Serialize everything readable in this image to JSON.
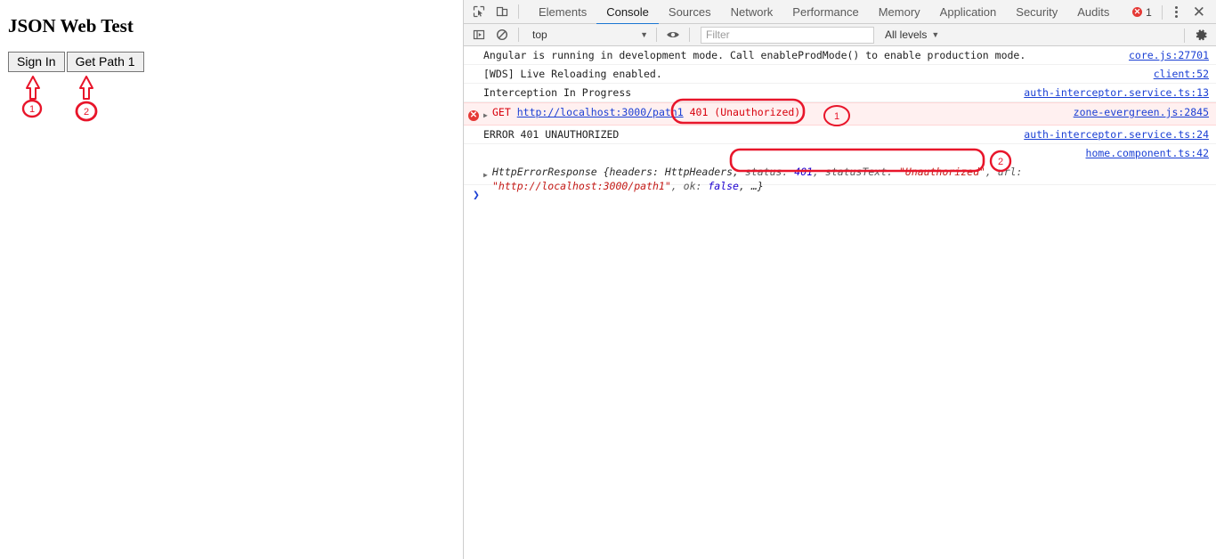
{
  "webpage": {
    "title": "JSON Web Test",
    "buttons": [
      {
        "label": "Sign In",
        "name": "sign-in-button"
      },
      {
        "label": "Get Path 1",
        "name": "get-path-1-button"
      }
    ],
    "annotations": [
      {
        "number": "1",
        "target": "Sign In button"
      },
      {
        "number": "2",
        "target": "Get Path 1 button"
      }
    ]
  },
  "devtools": {
    "tabs": [
      {
        "label": "Elements",
        "active": false
      },
      {
        "label": "Console",
        "active": true
      },
      {
        "label": "Sources",
        "active": false
      },
      {
        "label": "Network",
        "active": false
      },
      {
        "label": "Performance",
        "active": false
      },
      {
        "label": "Memory",
        "active": false
      },
      {
        "label": "Application",
        "active": false
      },
      {
        "label": "Security",
        "active": false
      },
      {
        "label": "Audits",
        "active": false
      }
    ],
    "error_count": "1",
    "error_badge_glyph": "✕",
    "close_glyph": "✕",
    "toolbar_icons": {
      "inspect": "inspect-element-icon",
      "device": "device-toolbar-icon",
      "sidebar": "console-sidebar-icon",
      "clear": "clear-console-icon",
      "eye": "live-expression-icon",
      "gear": "settings-gear-icon"
    },
    "console_toolbar": {
      "context": "top",
      "context_caret": "▼",
      "filter_placeholder": "Filter",
      "filter_value": "",
      "levels": "All levels",
      "levels_caret": "▼"
    },
    "messages": [
      {
        "type": "log",
        "text": "Angular is running in development mode. Call enableProdMode() to enable production mode.",
        "source": "core.js:27701"
      },
      {
        "type": "log",
        "text": "[WDS] Live Reloading enabled.",
        "source": "client:52"
      },
      {
        "type": "log",
        "text": "Interception In Progress",
        "source": "auth-interceptor.service.ts:13"
      },
      {
        "type": "error",
        "method": "GET",
        "url": "http://localhost:3000/path1",
        "status_text": "401 (Unauthorized)",
        "source": "zone-evergreen.js:2845"
      },
      {
        "type": "log",
        "text": "ERROR 401 UNAUTHORIZED",
        "source": "auth-interceptor.service.ts:24"
      },
      {
        "type": "object",
        "class_name": "HttpErrorResponse",
        "prefix": " {headers: HttpHeaders, ",
        "k_status": "status: ",
        "v_status": "401",
        "k_statusText": ", statusText: ",
        "v_statusText": "\"Unauthorized\"",
        "k_url": ", url: ",
        "v_url": "\"http://localhost:3000/path1\"",
        "k_ok": ", ok: ",
        "v_ok": "false",
        "suffix": ", …}",
        "source": "home.component.ts:42"
      }
    ],
    "prompt": "❯"
  },
  "annotations": {
    "marker_color": "#e8152a",
    "boxes": [
      {
        "label": "401-status-highlight",
        "around": "401 (Unauthorized)"
      },
      {
        "label": "status-fields-highlight",
        "around": "status: 401, statusText: \"Unauthorized\", url:"
      }
    ],
    "circles": [
      {
        "number": "1"
      },
      {
        "number": "2"
      }
    ]
  }
}
